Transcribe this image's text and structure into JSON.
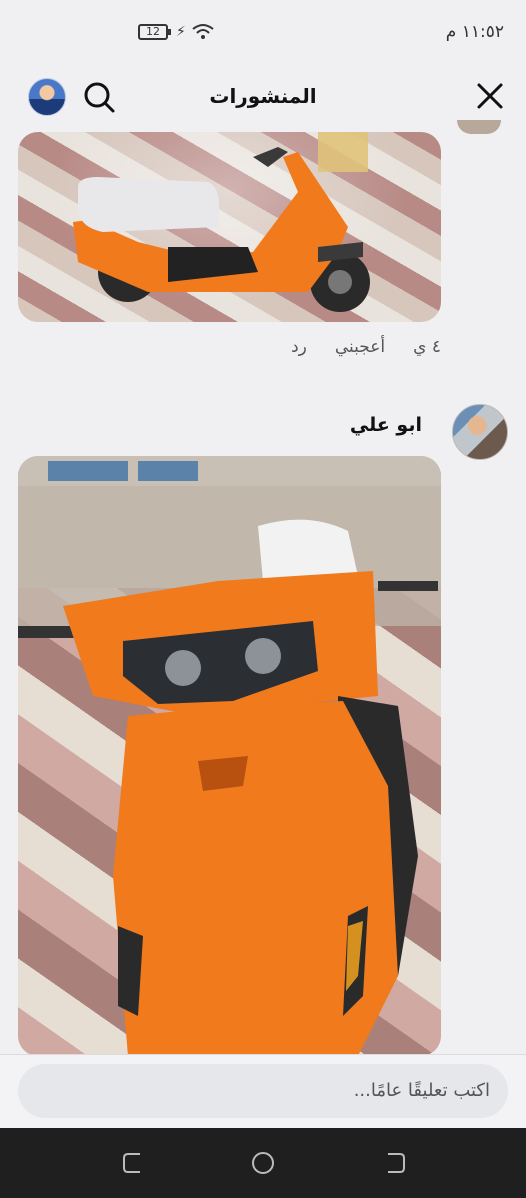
{
  "status": {
    "time": "١١:٥٢ م",
    "battery": "12",
    "charge_symbol": "⚡"
  },
  "header": {
    "title": "المنشورات"
  },
  "post": {
    "like_count": "٤ ي",
    "like_label": "أعجبني",
    "reply_label": "رد"
  },
  "comment": {
    "author": "ابو علي"
  },
  "compose": {
    "placeholder": "اكتب تعليقًا عامًا..."
  },
  "icons": {
    "close": "close-icon",
    "search": "search-icon",
    "nav_back": "back-icon",
    "nav_home": "home-icon",
    "nav_recent": "recent-apps-icon"
  },
  "colors": {
    "scooter_orange": "#f07a1c",
    "nav_background": "#1f1f1f"
  }
}
